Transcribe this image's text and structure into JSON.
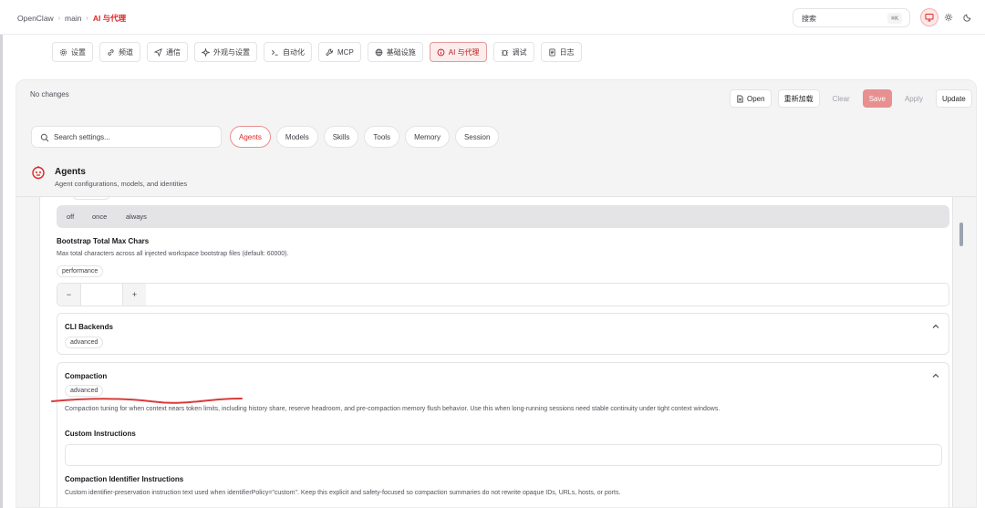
{
  "breadcrumb": {
    "root": "OpenClaw",
    "middle": "main",
    "current": "AI 与代理"
  },
  "top_search": {
    "placeholder": "搜索",
    "shortcut": "⌘K"
  },
  "theme_icons": [
    "monitor-icon",
    "sun-icon",
    "moon-icon"
  ],
  "nav_tabs": [
    {
      "label": "设置",
      "icon": "gear-icon"
    },
    {
      "label": "频道",
      "icon": "link-icon"
    },
    {
      "label": "通信",
      "icon": "send-icon"
    },
    {
      "label": "外观与设置",
      "icon": "sparkle-icon"
    },
    {
      "label": "自动化",
      "icon": "terminal-icon"
    },
    {
      "label": "MCP",
      "icon": "wrench-icon"
    },
    {
      "label": "基础设施",
      "icon": "globe-icon"
    },
    {
      "label": "AI 与代理",
      "icon": "info-icon",
      "active": true
    },
    {
      "label": "调试",
      "icon": "bug-icon"
    },
    {
      "label": "日志",
      "icon": "log-icon"
    }
  ],
  "status": "No changes",
  "actions": {
    "open": "Open",
    "reload": "重新加载",
    "clear": "Clear",
    "save": "Save",
    "apply": "Apply",
    "update": "Update"
  },
  "settings_search": {
    "placeholder": "Search settings..."
  },
  "sub_tabs": [
    "Agents",
    "Models",
    "Skills",
    "Tools",
    "Memory",
    "Session"
  ],
  "section": {
    "title": "Agents",
    "subtitle": "Agent configurations, models, and identities"
  },
  "cut_chip": "advanced",
  "segmented": [
    "off",
    "once",
    "always"
  ],
  "bootstrap": {
    "label": "Bootstrap Total Max Chars",
    "description": "Max total characters across all injected workspace bootstrap files (default: 60000).",
    "tag": "performance",
    "minus": "−",
    "plus": "+",
    "value": ""
  },
  "cli_backends": {
    "label": "CLI Backends",
    "tag": "advanced"
  },
  "compaction": {
    "label": "Compaction",
    "tag": "advanced",
    "description": "Compaction tuning for when context nears token limits, including history share, reserve headroom, and pre-compaction memory flush behavior. Use this when long-running sessions need stable continuity under tight context windows.",
    "custom_label": "Custom Instructions",
    "custom_value": "",
    "identifier_label": "Compaction Identifier Instructions",
    "identifier_desc": "Custom identifier-preservation instruction text used when identifierPolicy=\"custom\". Keep this explicit and safety-focused so compaction summaries do not rewrite opaque IDs, URLs, hosts, or ports."
  },
  "colors": {
    "accent": "#dc2626",
    "save": "#e88f8f",
    "annotation": "#d93b3b",
    "panel": "#f4f4f5"
  }
}
